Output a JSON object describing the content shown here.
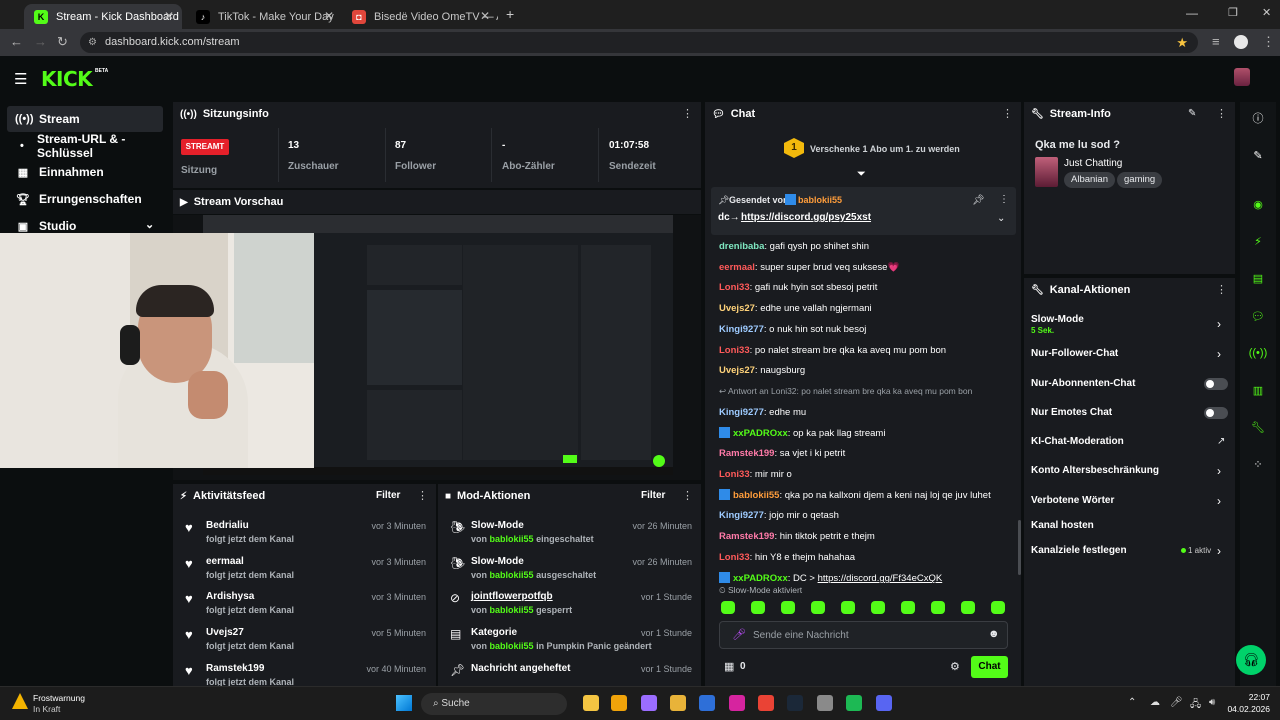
{
  "browser": {
    "tabs": [
      {
        "label": "Stream - Kick Dashboard",
        "favicon": "K"
      },
      {
        "label": "TikTok - Make Your Day",
        "favicon": "♪"
      },
      {
        "label": "Bisedë Video OmeTV — Altern…",
        "favicon": "◘"
      }
    ],
    "url": "dashboard.kick.com/stream",
    "new_tab": "+",
    "window_controls": [
      "—",
      "❐",
      "✕"
    ]
  },
  "brand": {
    "logo": "KICK",
    "beta": "BETA",
    "accent": "#53fc18"
  },
  "sidebar": {
    "items": [
      {
        "label": "Stream",
        "icon": "stream-icon"
      },
      {
        "label": "Stream-URL & -Schlüssel",
        "icon": "key-icon"
      },
      {
        "label": "Einnahmen",
        "icon": "revenue-icon"
      },
      {
        "label": "Errungenschaften",
        "icon": "trophy-icon"
      },
      {
        "label": "Studio",
        "icon": "studio-icon"
      }
    ]
  },
  "session": {
    "title": "Sitzungsinfo",
    "badge": "STREAMT",
    "stats": [
      {
        "value": "",
        "label": "Sitzung"
      },
      {
        "value": "13",
        "label": "Zuschauer"
      },
      {
        "value": "87",
        "label": "Follower"
      },
      {
        "value": "-",
        "label": "Abo-Zähler"
      },
      {
        "value": "01:07:58",
        "label": "Sendezeit"
      }
    ]
  },
  "preview": {
    "title": "Stream Vorschau"
  },
  "activity": {
    "title": "Aktivitätsfeed",
    "filter": "Filter",
    "items": [
      {
        "name": "Bedrialiu",
        "action": "folgt jetzt dem Kanal",
        "time": "vor 3 Minuten"
      },
      {
        "name": "eermaal",
        "action": "folgt jetzt dem Kanal",
        "time": "vor 3 Minuten"
      },
      {
        "name": "Ardishysa",
        "action": "folgt jetzt dem Kanal",
        "time": "vor 3 Minuten"
      },
      {
        "name": "Uvejs27",
        "action": "folgt jetzt dem Kanal",
        "time": "vor 5 Minuten"
      },
      {
        "name": "Ramstek199",
        "action": "folgt jetzt dem Kanal",
        "time": "vor 40 Minuten"
      }
    ]
  },
  "mod": {
    "title": "Mod-Aktionen",
    "filter": "Filter",
    "items": [
      {
        "title": "Slow-Mode",
        "by": "von",
        "user": "bablokii55",
        "rest": "eingeschaltet",
        "time": "vor 26 Minuten"
      },
      {
        "title": "Slow-Mode",
        "by": "von",
        "user": "bablokii55",
        "rest": "ausgeschaltet",
        "time": "vor 26 Minuten"
      },
      {
        "title": "jointflowerpotfqb",
        "by": "von",
        "user": "bablokii55",
        "rest": "gesperrt",
        "time": "vor 1 Stunde"
      },
      {
        "title": "Kategorie",
        "by": "von",
        "user": "bablokii55",
        "rest": "in Pumpkin Panic geändert",
        "time": "vor 1 Stunde"
      },
      {
        "title": "Nachricht angeheftet",
        "by": "",
        "user": "",
        "rest": "",
        "time": "vor 1 Stunde"
      }
    ]
  },
  "chat": {
    "title": "Chat",
    "gift_banner": "Verschenke 1 Abo um 1. zu werden",
    "gift_count": "1",
    "pinned": {
      "sent_by": "Gesendet von",
      "user": "bablokii55",
      "prefix": "dc→",
      "link": "https://discord.gg/psy25xst"
    },
    "messages": [
      {
        "user": "drenibaba",
        "color": "#7fe8c1",
        "text": ": gafi qysh po shihet shin"
      },
      {
        "user": "eermaal",
        "color": "#ff5a5a",
        "text": ": super super brud veq suksese💗"
      },
      {
        "user": "Loni33",
        "color": "#ff5a5a",
        "text": ": gafi nuk hyin sot sbesoj petrit"
      },
      {
        "user": "Uvejs27",
        "color": "#ffd37a",
        "text": ": edhe une vallah ngjermani"
      },
      {
        "user": "Kingi9277",
        "color": "#9ecbff",
        "text": ": o nuk hin sot nuk besoj"
      },
      {
        "user": "Loni33",
        "color": "#ff5a5a",
        "text": ": po nalet stream bre qka ka aveq mu pom bon"
      },
      {
        "user": "Uvejs27",
        "color": "#ffd37a",
        "text": ": naugsburg"
      },
      {
        "reply": "Antwort an Loni32: po nalet stream bre qka ka aveq mu pom bon"
      },
      {
        "user": "Kingi9277",
        "color": "#9ecbff",
        "text": ": edhe mu"
      },
      {
        "user": "xxPADROxx",
        "color": "#53fc18",
        "text": ": op ka pak llag streami",
        "mod": true
      },
      {
        "user": "Ramstek199",
        "color": "#ff7aa8",
        "text": ": sa vjet i ki petrit"
      },
      {
        "user": "Loni33",
        "color": "#ff5a5a",
        "text": ": mir mir o"
      },
      {
        "user": "bablokii55",
        "color": "#ff9d3b",
        "text": ": qka po na kallxoni djem a keni naj loj qe juv luhet",
        "mod": true
      },
      {
        "user": "Kingi9277",
        "color": "#9ecbff",
        "text": ": jojo mir o qetash"
      },
      {
        "user": "Ramstek199",
        "color": "#ff7aa8",
        "text": ": hin tiktok petrit e thejm"
      },
      {
        "user": "Loni33",
        "color": "#ff5a5a",
        "text": ": hin Y8 e thejm hahahaa"
      },
      {
        "user": "xxPADROxx",
        "color": "#53fc18",
        "text": ": DC > ",
        "link": "https://discord.gg/Ff34eCxQK",
        "mod": true
      }
    ],
    "slow_mode_notice": "Slow-Mode aktiviert",
    "input_placeholder": "Sende eine Nachricht",
    "points": "0",
    "send_button": "Chat"
  },
  "stream_info": {
    "title": "Stream-Info",
    "stream_title": "Qka me lu sod ?",
    "category": "Just Chatting",
    "tags": [
      "Albanian",
      "gaming"
    ]
  },
  "channel_actions": {
    "title": "Kanal-Aktionen",
    "items": [
      {
        "label": "Slow-Mode",
        "sub": "5 Sek.",
        "control": "chevron"
      },
      {
        "label": "Nur-Follower-Chat",
        "control": "chevron"
      },
      {
        "label": "Nur-Abonnenten-Chat",
        "control": "toggle"
      },
      {
        "label": "Nur Emotes Chat",
        "control": "toggle"
      },
      {
        "label": "KI-Chat-Moderation",
        "control": "external"
      },
      {
        "label": "Konto Altersbeschränkung",
        "control": "chevron"
      },
      {
        "label": "Verbotene Wörter",
        "control": "chevron"
      },
      {
        "label": "Kanal hosten",
        "control": "none"
      },
      {
        "label": "Kanalziele festlegen",
        "badge": "1 aktiv",
        "control": "chevron"
      }
    ]
  },
  "taskbar": {
    "weather_title": "Frostwarnung",
    "weather_sub": "In Kraft",
    "search": "Suche",
    "time": "22:07",
    "date": "04.02.2026"
  }
}
